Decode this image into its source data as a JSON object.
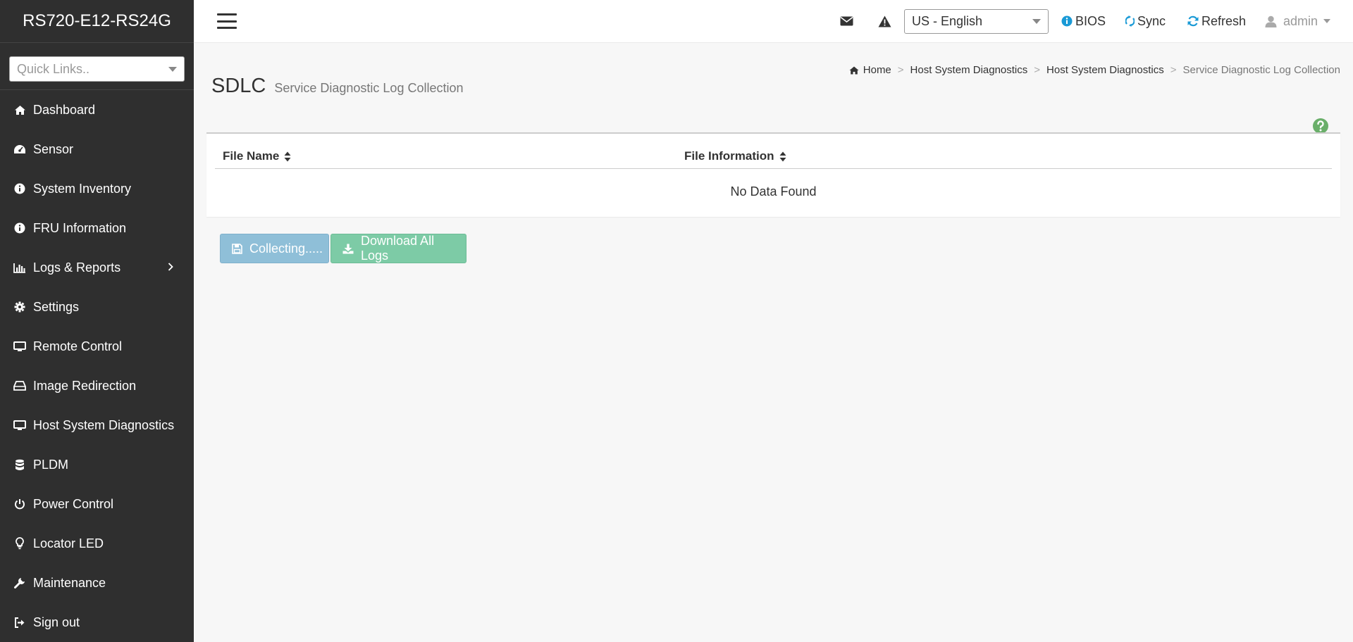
{
  "brand": {
    "title": "RS720-E12-RS24G"
  },
  "quicklinks": {
    "placeholder": "Quick Links.."
  },
  "sidebar": {
    "items": [
      {
        "label": "Dashboard",
        "icon": "home-icon"
      },
      {
        "label": "Sensor",
        "icon": "dashboard-gauge-icon"
      },
      {
        "label": "System Inventory",
        "icon": "info-circle-icon"
      },
      {
        "label": "FRU Information",
        "icon": "info-circle-icon"
      },
      {
        "label": "Logs & Reports",
        "icon": "bar-chart-icon",
        "has_submenu": true
      },
      {
        "label": "Settings",
        "icon": "gear-icon"
      },
      {
        "label": "Remote Control",
        "icon": "monitor-icon"
      },
      {
        "label": "Image Redirection",
        "icon": "hard-drive-icon"
      },
      {
        "label": "Host System Diagnostics",
        "icon": "monitor-icon"
      },
      {
        "label": "PLDM",
        "icon": "database-icon"
      },
      {
        "label": "Power Control",
        "icon": "power-icon"
      },
      {
        "label": "Locator LED",
        "icon": "lightbulb-icon"
      },
      {
        "label": "Maintenance",
        "icon": "wrench-icon"
      },
      {
        "label": "Sign out",
        "icon": "sign-out-icon"
      }
    ]
  },
  "header": {
    "language": "US - English",
    "bios_label": "BIOS",
    "sync_label": "Sync",
    "refresh_label": "Refresh",
    "user_label": "admin",
    "accent_color": "#1a9ad6"
  },
  "page": {
    "title": "SDLC",
    "subtitle": "Service Diagnostic Log Collection"
  },
  "breadcrumb": {
    "home": "Home",
    "level1": "Host System Diagnostics",
    "level2": "Host System Diagnostics",
    "current": "Service Diagnostic Log Collection"
  },
  "table": {
    "columns": [
      "File Name",
      "File Information"
    ],
    "empty_text": "No Data Found"
  },
  "buttons": {
    "collect_label": "Collecting.....",
    "download_label": "Download All Logs"
  }
}
